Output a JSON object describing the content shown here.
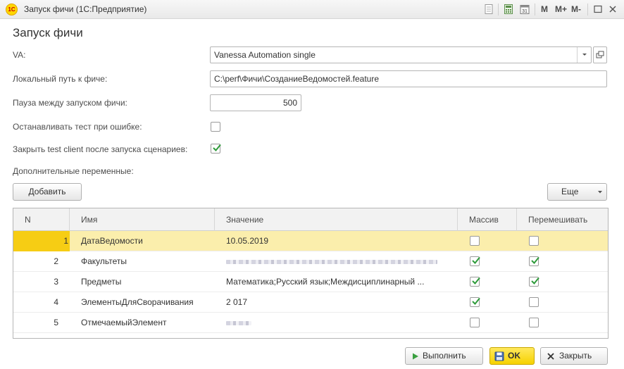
{
  "window": {
    "title": "Запуск фичи  (1С:Предприятие)",
    "logo_text": "1С",
    "toolbar": {
      "m": "M",
      "m_plus": "M+",
      "m_minus": "M-"
    }
  },
  "form": {
    "title": "Запуск фичи",
    "va_label": "VA:",
    "va_value": "Vanessa Automation single",
    "path_label": "Локальный путь к фиче:",
    "path_value": "C:\\perf\\Фичи\\СозданиеВедомостей.feature",
    "pause_label": "Пауза между запуском фичи:",
    "pause_value": "500",
    "stop_label": "Останавливать тест при ошибке:",
    "stop_checked": false,
    "close_label": "Закрыть test client после запуска сценариев:",
    "close_checked": true,
    "vars_label": "Дополнительные переменные:"
  },
  "buttons": {
    "add": "Добавить",
    "more": "Еще",
    "run": "Выполнить",
    "ok": "OK",
    "close": "Закрыть"
  },
  "table": {
    "columns": [
      "N",
      "Имя",
      "Значение",
      "Массив",
      "Перемешивать"
    ],
    "rows": [
      {
        "n": "1",
        "name": "ДатаВедомости",
        "value": "10.05.2019",
        "massiv": false,
        "peremeshivat": false,
        "selected": true
      },
      {
        "n": "2",
        "name": "Факультеты",
        "value": "",
        "massiv": true,
        "peremeshivat": true,
        "selected": false
      },
      {
        "n": "3",
        "name": "Предметы",
        "value": "Математика;Русский язык;Междисциплинарный ...",
        "massiv": true,
        "peremeshivat": true,
        "selected": false
      },
      {
        "n": "4",
        "name": "ЭлементыДляСворачивания",
        "value": "2 017",
        "massiv": true,
        "peremeshivat": false,
        "selected": false
      },
      {
        "n": "5",
        "name": "ОтмечаемыйЭлемент",
        "value": "",
        "massiv": false,
        "peremeshivat": false,
        "selected": false
      }
    ]
  },
  "colors": {
    "accent_yellow": "#f6cd14",
    "selected_row": "#fbeeac",
    "check_green": "#2e9b3a"
  }
}
